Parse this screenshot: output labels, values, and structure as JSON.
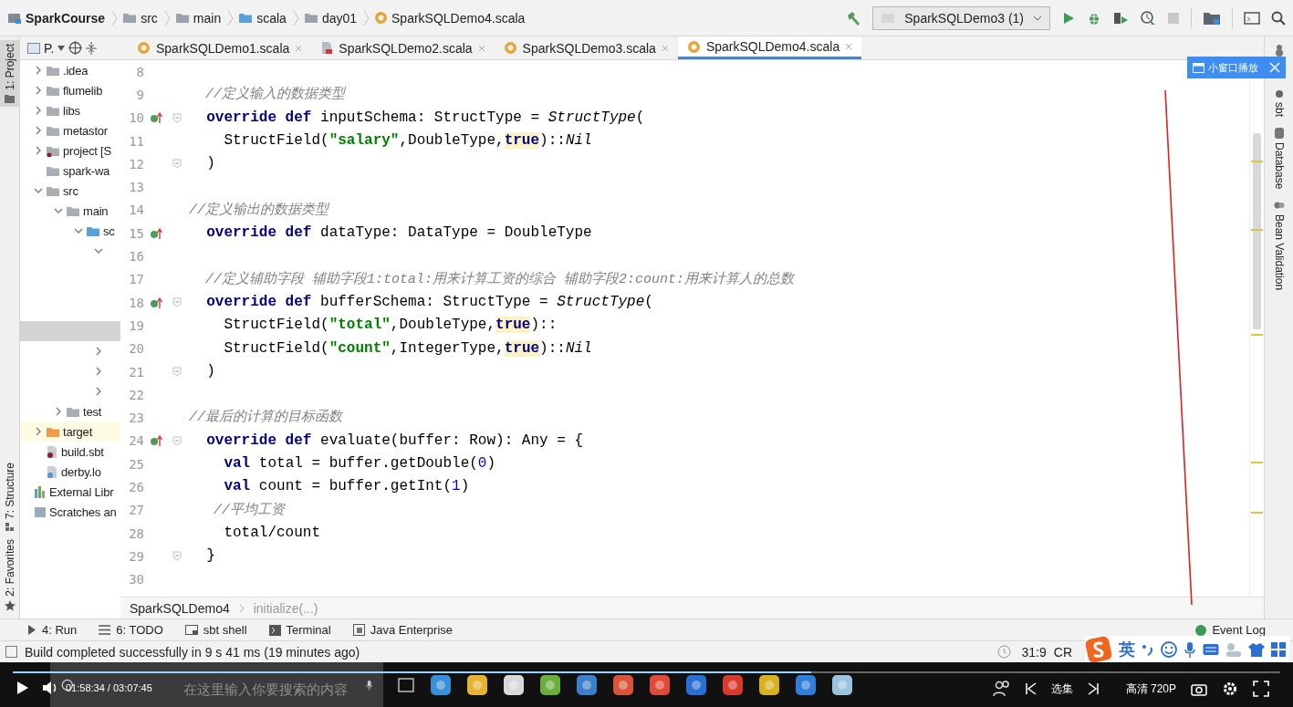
{
  "breadcrumb": [
    {
      "label": "SparkCourse",
      "kind": "project"
    },
    {
      "label": "src",
      "kind": "folder"
    },
    {
      "label": "main",
      "kind": "folder"
    },
    {
      "label": "scala",
      "kind": "source"
    },
    {
      "label": "day01",
      "kind": "package"
    },
    {
      "label": "SparkSQLDemo4.scala",
      "kind": "file"
    }
  ],
  "run_config": "SparkSQLDemo3 (1)",
  "left_stripe": [
    {
      "label": "1: Project",
      "kind": "project",
      "selected": true
    },
    {
      "label": "7: Structure",
      "kind": "structure",
      "selected": false
    },
    {
      "label": "2: Favorites",
      "kind": "favorites",
      "selected": false
    }
  ],
  "project_panel": {
    "title": "P.",
    "tree": [
      {
        "label": ".idea",
        "kind": "folder",
        "expanded": false,
        "selected": false
      },
      {
        "label": "flumelib",
        "kind": "folder",
        "expanded": false,
        "selected": false
      },
      {
        "label": "libs",
        "kind": "folder",
        "expanded": false,
        "selected": false
      },
      {
        "label": "metastor",
        "kind": "folder",
        "expanded": false,
        "selected": false
      },
      {
        "label": "project [S",
        "kind": "module",
        "expanded": false,
        "selected": false
      },
      {
        "label": "spark-wa",
        "kind": "folder",
        "selected": false
      },
      {
        "label": "src",
        "kind": "folder",
        "expanded": true,
        "selected": false,
        "children": [
          {
            "label": "main",
            "kind": "folder",
            "expanded": true,
            "selected": false,
            "children": [
              {
                "label": "sc",
                "kind": "source",
                "expanded": true,
                "selected": false,
                "children": [
                  {
                    "expanded": true,
                    "selected": false,
                    "children": [
                      {
                        "selected": false
                      },
                      {
                        "selected": false
                      },
                      {
                        "selected": false
                      },
                      {
                        "selected": true
                      }
                    ]
                  },
                  {
                    "expanded": false,
                    "selected": false
                  },
                  {
                    "expanded": false,
                    "selected": false
                  },
                  {
                    "expanded": false,
                    "selected": false
                  }
                ]
              }
            ]
          },
          {
            "label": "test",
            "kind": "folder",
            "expanded": false,
            "selected": false
          }
        ]
      },
      {
        "label": "target",
        "kind": "excluded",
        "expanded": false,
        "selected": false
      },
      {
        "label": "build.sbt",
        "kind": "sbt",
        "selected": false
      },
      {
        "label": "derby.lo",
        "kind": "log",
        "selected": false
      },
      {
        "label": "External Libr",
        "kind": "library",
        "selected": false
      },
      {
        "label": "Scratches an",
        "kind": "scratch",
        "selected": false
      }
    ]
  },
  "tabs": [
    {
      "label": "SparkSQLDemo1.scala",
      "kind": "scala",
      "selected": false
    },
    {
      "label": "SparkSQLDemo2.scala",
      "kind": "script",
      "selected": false
    },
    {
      "label": "SparkSQLDemo3.scala",
      "kind": "scala",
      "selected": false
    },
    {
      "label": "SparkSQLDemo4.scala",
      "kind": "scala",
      "selected": true
    }
  ],
  "editor": {
    "lines": [
      {
        "number": "8",
        "override": false,
        "fold": false
      },
      {
        "number": "9",
        "override": false,
        "fold": false,
        "tokens": [
          {
            "kind": "comment",
            "text": "  //定义输入的数据类型"
          }
        ]
      },
      {
        "number": "10",
        "override": true,
        "fold": true,
        "tokens": [
          {
            "kind": "keyword",
            "text": "  override def"
          },
          {
            "kind": "plain",
            "text": " inputSchema: StructType = "
          },
          {
            "kind": "italic",
            "text": "StructType"
          },
          {
            "kind": "plain",
            "text": "("
          }
        ]
      },
      {
        "number": "11",
        "override": false,
        "fold": false,
        "tokens": [
          {
            "kind": "plain",
            "text": "    StructField("
          },
          {
            "kind": "string",
            "text": "\"salary\""
          },
          {
            "kind": "plain",
            "text": ",DoubleType,"
          },
          {
            "kind": "match",
            "text": "true"
          },
          {
            "kind": "plain",
            "text": ")::"
          },
          {
            "kind": "italic",
            "text": "Nil"
          }
        ]
      },
      {
        "number": "12",
        "override": false,
        "fold": true,
        "tokens": [
          {
            "kind": "plain",
            "text": "  )"
          }
        ]
      },
      {
        "number": "13",
        "override": false,
        "fold": false
      },
      {
        "number": "14",
        "override": false,
        "fold": false,
        "tokens": [
          {
            "kind": "comment",
            "text": "//定义输出的数据类型"
          }
        ]
      },
      {
        "number": "15",
        "override": true,
        "fold": false,
        "tokens": [
          {
            "kind": "keyword",
            "text": "  override def"
          },
          {
            "kind": "plain",
            "text": " dataType: DataType = DoubleType"
          }
        ]
      },
      {
        "number": "16",
        "override": false,
        "fold": false
      },
      {
        "number": "17",
        "override": false,
        "fold": false,
        "tokens": [
          {
            "kind": "comment",
            "text": "  //定义辅助字段 辅助字段1:total:用来计算工资的综合 辅助字段2:count:用来计算人的总数"
          }
        ]
      },
      {
        "number": "18",
        "override": true,
        "fold": true,
        "tokens": [
          {
            "kind": "keyword",
            "text": "  override def"
          },
          {
            "kind": "plain",
            "text": " bufferSchema: StructType = "
          },
          {
            "kind": "italic",
            "text": "StructType"
          },
          {
            "kind": "plain",
            "text": "("
          }
        ]
      },
      {
        "number": "19",
        "override": false,
        "fold": false,
        "tokens": [
          {
            "kind": "plain",
            "text": "    StructField("
          },
          {
            "kind": "string",
            "text": "\"total\""
          },
          {
            "kind": "plain",
            "text": ",DoubleType,"
          },
          {
            "kind": "match",
            "text": "true"
          },
          {
            "kind": "plain",
            "text": ")::"
          }
        ]
      },
      {
        "number": "20",
        "override": false,
        "fold": false,
        "tokens": [
          {
            "kind": "plain",
            "text": "    StructField("
          },
          {
            "kind": "string",
            "text": "\"count\""
          },
          {
            "kind": "plain",
            "text": ",IntegerType,"
          },
          {
            "kind": "match",
            "text": "true"
          },
          {
            "kind": "plain",
            "text": ")::"
          },
          {
            "kind": "italic",
            "text": "Nil"
          }
        ]
      },
      {
        "number": "21",
        "override": false,
        "fold": true,
        "tokens": [
          {
            "kind": "plain",
            "text": "  )"
          }
        ]
      },
      {
        "number": "22",
        "override": false,
        "fold": false
      },
      {
        "number": "23",
        "override": false,
        "fold": false,
        "tokens": [
          {
            "kind": "comment",
            "text": "//最后的计算的目标函数"
          }
        ]
      },
      {
        "number": "24",
        "override": true,
        "fold": true,
        "tokens": [
          {
            "kind": "keyword",
            "text": "  override def"
          },
          {
            "kind": "plain",
            "text": " evaluate(buffer: Row): Any = {"
          }
        ]
      },
      {
        "number": "25",
        "override": false,
        "fold": false,
        "tokens": [
          {
            "kind": "keyword",
            "text": "    val"
          },
          {
            "kind": "plain",
            "text": " total = buffer.getDouble("
          },
          {
            "kind": "number",
            "text": "0"
          },
          {
            "kind": "plain",
            "text": ")"
          }
        ]
      },
      {
        "number": "26",
        "override": false,
        "fold": false,
        "tokens": [
          {
            "kind": "keyword",
            "text": "    val"
          },
          {
            "kind": "plain",
            "text": " count = buffer.getInt("
          },
          {
            "kind": "number",
            "text": "1"
          },
          {
            "kind": "plain",
            "text": ")"
          }
        ]
      },
      {
        "number": "27",
        "override": false,
        "fold": false,
        "tokens": [
          {
            "kind": "comment",
            "text": "   //平均工资"
          }
        ]
      },
      {
        "number": "28",
        "override": false,
        "fold": false,
        "tokens": [
          {
            "kind": "plain",
            "text": "    total/count"
          }
        ]
      },
      {
        "number": "29",
        "override": false,
        "fold": true,
        "tokens": [
          {
            "kind": "plain",
            "text": "  }"
          }
        ]
      },
      {
        "number": "30",
        "override": false,
        "fold": false
      }
    ]
  },
  "right_stripe": [
    {
      "label": "sbt",
      "kind": "sbt"
    },
    {
      "label": "Database",
      "kind": "database"
    },
    {
      "label": "Bean Validation",
      "kind": "bean"
    }
  ],
  "popup": {
    "label": "小窗口播放"
  },
  "nav_bar": [
    {
      "label": "SparkSQLDemo4",
      "kind": "class"
    },
    {
      "label": "initialize(...)",
      "kind": "method"
    }
  ],
  "tool_windows": [
    {
      "label": "4: Run",
      "kind": "run"
    },
    {
      "label": "6: TODO",
      "kind": "todo"
    },
    {
      "label": "sbt shell",
      "kind": "shell"
    },
    {
      "label": "Terminal",
      "kind": "terminal"
    },
    {
      "label": "Java Enterprise",
      "kind": "enterprise"
    }
  ],
  "event_log": "Event Log",
  "status": {
    "message": "Build completed successfully in 9 s 41 ms (19 minutes ago)",
    "position": "31:9",
    "line_separator": "CR"
  },
  "ime": {
    "language": "英"
  },
  "taskbar": {
    "search": {
      "placeholder": "在这里输入你要搜索的内容"
    }
  },
  "player": {
    "time": "01:58:34 / 03:07:45",
    "progress": {
      "level": 0.63
    },
    "episodes": "选集",
    "quality": "高清 720P"
  }
}
